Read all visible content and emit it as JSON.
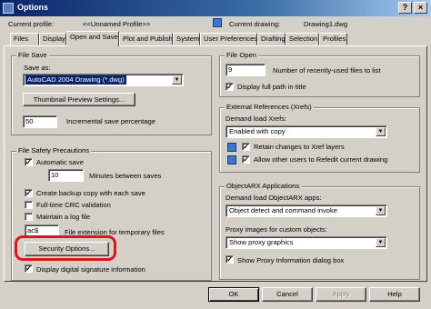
{
  "window": {
    "title": "Options"
  },
  "header": {
    "current_profile_label": "Current profile:",
    "current_profile_value": "<<Unnamed Profile>>",
    "current_drawing_label": "Current drawing:",
    "current_drawing_value": "Drawing1.dwg"
  },
  "tabs": [
    {
      "label": "Files"
    },
    {
      "label": "Display"
    },
    {
      "label": "Open and Save",
      "active": true
    },
    {
      "label": "Plot and Publish"
    },
    {
      "label": "System"
    },
    {
      "label": "User Preferences"
    },
    {
      "label": "Drafting"
    },
    {
      "label": "Selection"
    },
    {
      "label": "Profiles"
    }
  ],
  "file_save": {
    "group_label": "File Save",
    "save_as_label": "Save as:",
    "save_as_value": "AutoCAD 2004 Drawing (*.dwg)",
    "thumbnail_button": "Thumbnail Preview Settings...",
    "incremental_value": "50",
    "incremental_label": "Incremental save percentage"
  },
  "file_safety": {
    "group_label": "File Safety Precautions",
    "automatic_save": {
      "label": "Automatic save",
      "checked": true
    },
    "minutes_value": "10",
    "minutes_label": "Minutes between saves",
    "backup_copy": {
      "label": "Create backup copy with each save",
      "checked": true
    },
    "crc_validation": {
      "label": "Full-time CRC validation",
      "checked": false
    },
    "log_file": {
      "label": "Maintain a log file",
      "checked": false
    },
    "temp_ext_value": "ac$",
    "temp_ext_label": "File extension for temporary files",
    "security_button": "Security Options...",
    "digital_signature": {
      "label": "Display digital signature information",
      "checked": true
    }
  },
  "file_open": {
    "group_label": "File Open",
    "recent_value": "9",
    "recent_label": "Number of recently-used files to list",
    "full_path": {
      "label": "Display full path in title",
      "checked": true
    }
  },
  "xrefs": {
    "group_label": "External References (Xrefs)",
    "demand_label": "Demand load Xrefs:",
    "demand_value": "Enabled with copy",
    "retain_changes": {
      "label": "Retain changes to Xref layers",
      "checked": true
    },
    "allow_refedit": {
      "label": "Allow other users to Refedit current drawing",
      "checked": true
    }
  },
  "objectarx": {
    "group_label": "ObjectARX Applications",
    "demand_label": "Demand load ObjectARX apps:",
    "demand_value": "Object detect and command invoke",
    "proxy_label": "Proxy images for custom objects:",
    "proxy_value": "Show proxy graphics",
    "proxy_info": {
      "label": "Show Proxy Information dialog box",
      "checked": true
    }
  },
  "footer": {
    "ok": "OK",
    "cancel": "Cancel",
    "apply": "Apply",
    "help": "Help"
  },
  "check_glyph": "✓"
}
